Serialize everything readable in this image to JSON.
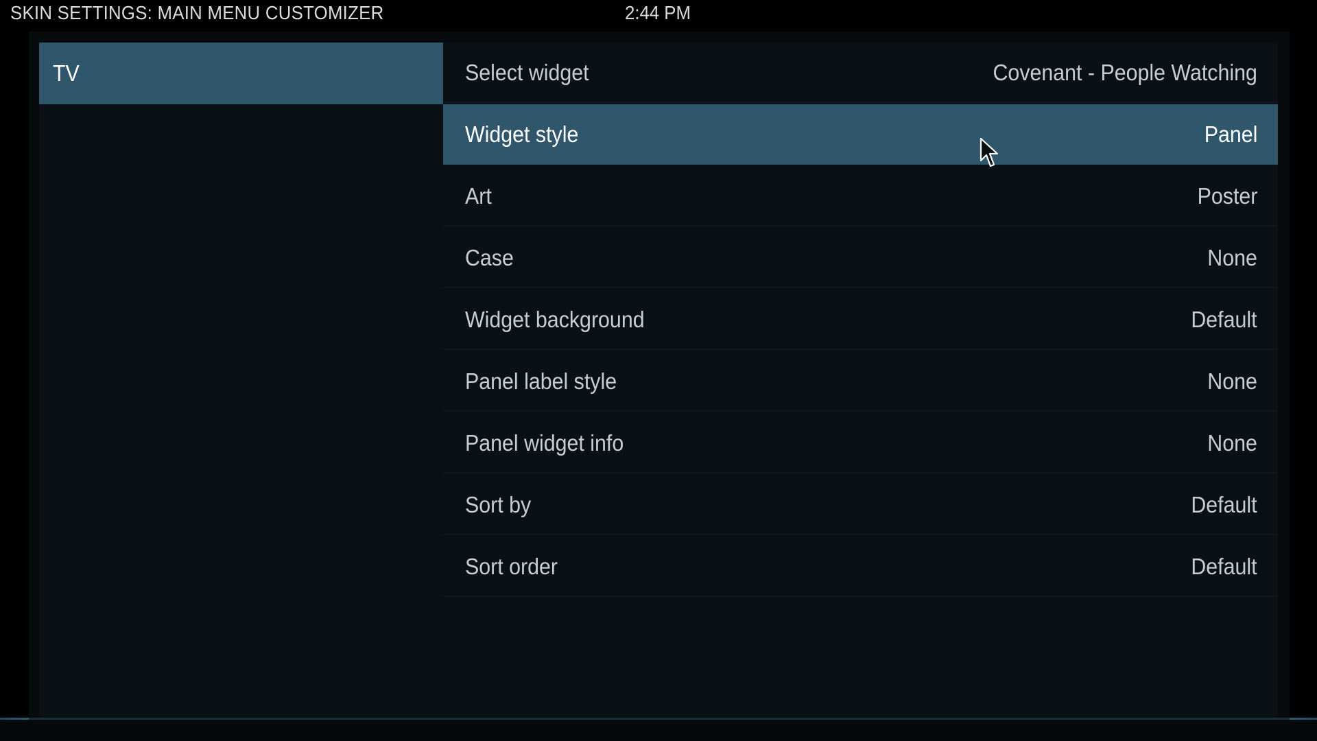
{
  "header": {
    "title": "SKIN SETTINGS: MAIN MENU CUSTOMIZER",
    "clock": "2:44 PM"
  },
  "menu": {
    "items": [
      {
        "label": "TV",
        "active": true
      }
    ]
  },
  "settings": [
    {
      "label": "Select widget",
      "value": "Covenant - People Watching"
    },
    {
      "label": "Widget style",
      "value": "Panel",
      "focused": true
    },
    {
      "label": "Art",
      "value": "Poster"
    },
    {
      "label": "Case",
      "value": "None"
    },
    {
      "label": "Widget background",
      "value": "Default"
    },
    {
      "label": "Panel label style",
      "value": "None"
    },
    {
      "label": "Panel widget info",
      "value": "None"
    },
    {
      "label": "Sort by",
      "value": "Default"
    },
    {
      "label": "Sort order",
      "value": "Default"
    }
  ],
  "cursor": {
    "icon": "mouse-pointer-icon"
  },
  "colors": {
    "background": "#000000",
    "panel": "#0a1115",
    "highlight": "#2f566b",
    "text": "#ffffff",
    "text_dim": "#c8cdd0"
  }
}
